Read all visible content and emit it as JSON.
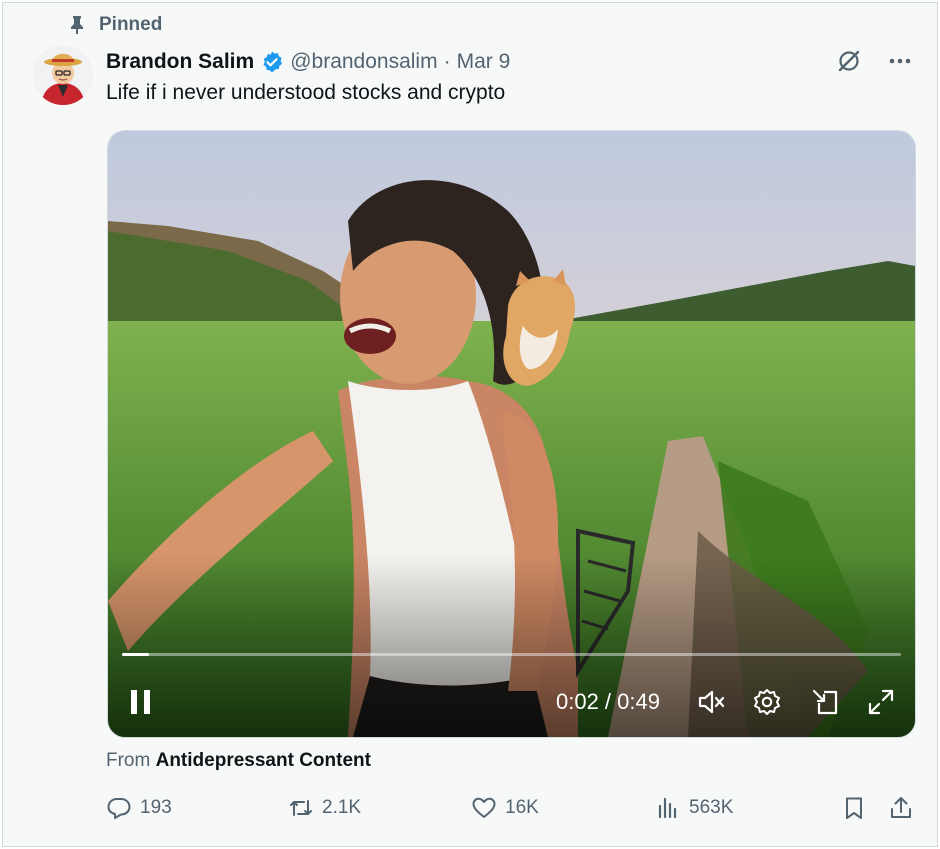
{
  "pinned_label": "Pinned",
  "author": {
    "name": "Brandon Salim",
    "handle": "@brandonsalim",
    "separator": "·",
    "date": "Mar 9"
  },
  "tweet": {
    "text": "Life if i never understood stocks and crypto"
  },
  "video": {
    "time": "0:02 / 0:49",
    "progress": 0.035
  },
  "source": {
    "prefix": "From",
    "name": "Antidepressant Content"
  },
  "actions": {
    "replies": "193",
    "reposts": "2.1K",
    "likes": "16K",
    "views": "563K"
  },
  "colors": {
    "verified": "#1d9bf0",
    "muted": "#536471",
    "text": "#0f1419"
  },
  "icons": [
    "pin-icon",
    "verified-badge-icon",
    "grok-icon",
    "more-icon",
    "pause-icon",
    "mute-icon",
    "settings-icon",
    "pip-icon",
    "fullscreen-icon",
    "reply-icon",
    "repost-icon",
    "like-icon",
    "views-icon",
    "bookmark-icon",
    "share-icon"
  ]
}
